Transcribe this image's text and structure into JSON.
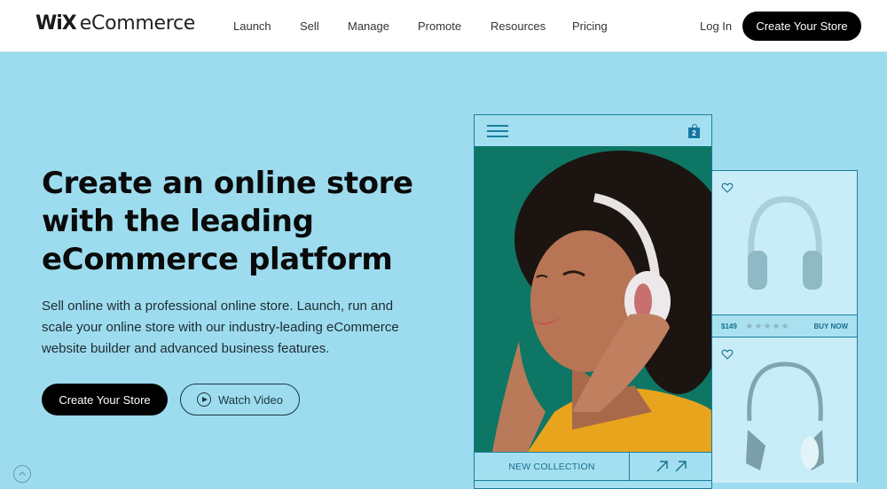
{
  "header": {
    "logo_brand": "WiX",
    "logo_product": "eCommerce",
    "nav": [
      {
        "label": "Launch"
      },
      {
        "label": "Sell"
      },
      {
        "label": "Manage"
      },
      {
        "label": "Promote"
      },
      {
        "label": "Resources"
      },
      {
        "label": "Pricing"
      }
    ],
    "login_label": "Log In",
    "cta_label": "Create Your Store"
  },
  "hero": {
    "title_lines": [
      "Create an online store",
      "with the leading",
      "eCommerce platform"
    ],
    "subtitle_lines": [
      "Sell online with a professional online store. Launch, run and",
      "scale your online store with our industry-leading eCommerce",
      "website builder and advanced business features."
    ],
    "primary_button": "Create Your Store",
    "video_button": "Watch Video"
  },
  "mockup": {
    "cart_count": "2",
    "collection_label": "NEW COLLECTION",
    "products": [
      {
        "price": "$149",
        "stars": "★★★★★",
        "action": "BUY NOW"
      }
    ]
  },
  "colors": {
    "background": "#9ddcee",
    "accent": "#1a7ea0",
    "button": "#000000"
  }
}
